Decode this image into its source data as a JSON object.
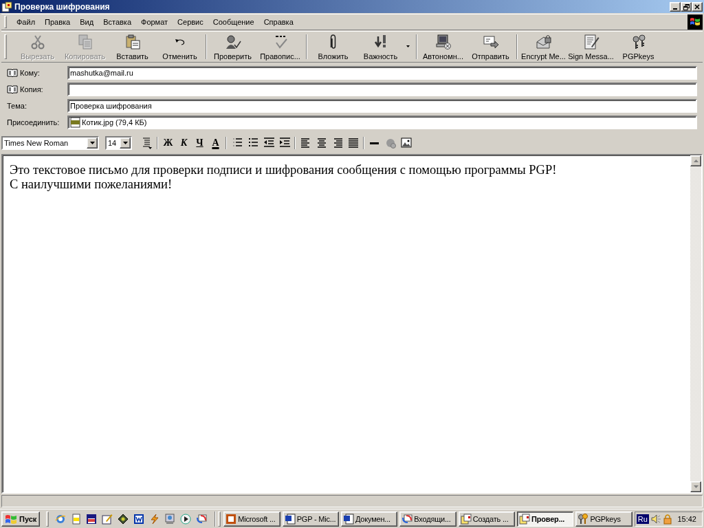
{
  "window": {
    "title": "Проверка шифрования"
  },
  "menu": [
    {
      "label": "Файл"
    },
    {
      "label": "Правка"
    },
    {
      "label": "Вид"
    },
    {
      "label": "Вставка"
    },
    {
      "label": "Формат"
    },
    {
      "label": "Сервис"
    },
    {
      "label": "Сообщение"
    },
    {
      "label": "Справка"
    }
  ],
  "toolbar": {
    "groups": [
      [
        {
          "label": "Вырезать",
          "disabled": true,
          "dropdown": false
        },
        {
          "label": "Копировать",
          "disabled": true,
          "dropdown": false
        },
        {
          "label": "Вставить",
          "disabled": false,
          "dropdown": false
        },
        {
          "label": "Отменить",
          "disabled": false,
          "dropdown": false
        }
      ],
      [
        {
          "label": "Проверить",
          "disabled": false,
          "dropdown": false
        },
        {
          "label": "Правопис...",
          "disabled": false,
          "dropdown": false
        }
      ],
      [
        {
          "label": "Вложить",
          "disabled": false,
          "dropdown": false
        },
        {
          "label": "Важность",
          "disabled": false,
          "dropdown": true
        }
      ],
      [
        {
          "label": "Автономн...",
          "disabled": false,
          "dropdown": false
        },
        {
          "label": "Отправить",
          "disabled": false,
          "dropdown": false
        }
      ],
      [
        {
          "label": "Encrypt Me...",
          "disabled": false,
          "dropdown": false
        },
        {
          "label": "Sign Messa...",
          "disabled": false,
          "dropdown": false
        },
        {
          "label": "PGPkeys",
          "disabled": false,
          "dropdown": false
        }
      ]
    ]
  },
  "fields": [
    {
      "kind": "address",
      "label": "Кому:",
      "value": "mashutka@mail.ru"
    },
    {
      "kind": "address",
      "label": "Копия:"
    },
    {
      "kind": "text",
      "label": "Тема:",
      "value": "Проверка шифрования"
    },
    {
      "kind": "attachment",
      "label": "Присоединить:",
      "value": "Котик.jpg (79,4 КБ)"
    }
  ],
  "format_bar": {
    "font": "Times New Roman",
    "size": "14",
    "style_buttons": [
      {
        "label": "Ж"
      },
      {
        "label": "К"
      },
      {
        "label": "Ч"
      },
      {
        "label": "А"
      }
    ]
  },
  "body": {
    "lines": [
      "Это текстовое письмо для проверки подписи и шифрования сообщения с помощью программы PGP!",
      "С наилучшими пожеланиями!"
    ]
  },
  "taskbar": {
    "start": "Пуск",
    "tasks": [
      {
        "label": "Microsoft ...",
        "selected": false
      },
      {
        "label": "PGP - Mic...",
        "selected": false
      },
      {
        "label": "Докумен...",
        "selected": false
      },
      {
        "label": "Входящи...",
        "selected": false
      },
      {
        "label": "Создать ...",
        "selected": false
      },
      {
        "label": "Провер...",
        "selected": true
      },
      {
        "label": "PGPkeys",
        "selected": false
      }
    ],
    "language": "Ru",
    "clock": "15:42"
  }
}
